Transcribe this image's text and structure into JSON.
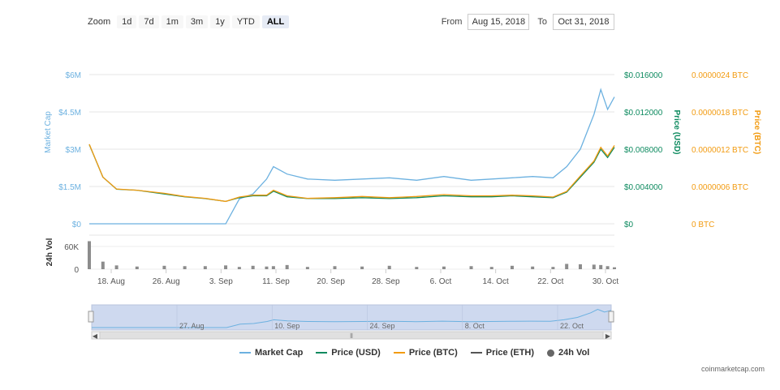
{
  "zoom": {
    "label": "Zoom",
    "buttons": [
      "1d",
      "7d",
      "1m",
      "3m",
      "1y",
      "YTD",
      "ALL"
    ],
    "active": "ALL"
  },
  "range": {
    "from_label": "From",
    "from_value": "Aug 15, 2018",
    "to_label": "To",
    "to_value": "Oct 31, 2018"
  },
  "credit": "coinmarketcap.com",
  "colors": {
    "market_cap": "#6cb1e0",
    "price_usd": "#0d8a5f",
    "price_btc": "#f29b11",
    "price_eth": "#555555",
    "volume": "#666666",
    "navigator_fill": "#ced9ef"
  },
  "legend": [
    {
      "label": "Market Cap",
      "icon": "line",
      "color": "#6cb1e0"
    },
    {
      "label": "Price (USD)",
      "icon": "line",
      "color": "#0d8a5f"
    },
    {
      "label": "Price (BTC)",
      "icon": "line",
      "color": "#f29b11"
    },
    {
      "label": "Price (ETH)",
      "icon": "line",
      "color": "#555555"
    },
    {
      "label": "24h Vol",
      "icon": "dot",
      "color": "#666666"
    }
  ],
  "chart_data": {
    "type": "line",
    "x": [
      "2018-08-15",
      "2018-08-17",
      "2018-08-19",
      "2018-08-22",
      "2018-08-26",
      "2018-08-29",
      "2018-09-01",
      "2018-09-04",
      "2018-09-06",
      "2018-09-08",
      "2018-09-10",
      "2018-09-11",
      "2018-09-13",
      "2018-09-16",
      "2018-09-20",
      "2018-09-24",
      "2018-09-28",
      "2018-10-02",
      "2018-10-06",
      "2018-10-10",
      "2018-10-13",
      "2018-10-16",
      "2018-10-19",
      "2018-10-22",
      "2018-10-24",
      "2018-10-26",
      "2018-10-28",
      "2018-10-29",
      "2018-10-30",
      "2018-10-31"
    ],
    "series": [
      {
        "name": "Market Cap",
        "axis": "market_cap",
        "values": [
          0,
          0,
          0,
          0,
          0,
          0,
          0,
          0,
          1.0,
          1.2,
          1.8,
          2.3,
          2.0,
          1.8,
          1.75,
          1.8,
          1.85,
          1.75,
          1.9,
          1.75,
          1.8,
          1.85,
          1.9,
          1.85,
          2.3,
          3.0,
          4.4,
          5.4,
          4.6,
          5.1
        ]
      },
      {
        "name": "Price (USD)",
        "axis": "usd",
        "values": [
          0.0085,
          0.005,
          0.0037,
          0.0036,
          0.0032,
          0.0029,
          0.0027,
          0.0024,
          0.0028,
          0.003,
          0.003,
          0.0035,
          0.0029,
          0.0027,
          0.0027,
          0.0028,
          0.0027,
          0.0028,
          0.003,
          0.0029,
          0.0029,
          0.003,
          0.0029,
          0.0028,
          0.0034,
          0.005,
          0.0066,
          0.008,
          0.0071,
          0.0082
        ]
      },
      {
        "name": "Price (BTC)",
        "axis": "btc",
        "values": [
          1.28e-06,
          7.5e-07,
          5.6e-07,
          5.4e-07,
          4.9e-07,
          4.4e-07,
          4.1e-07,
          3.6e-07,
          4.3e-07,
          4.6e-07,
          4.6e-07,
          5.4e-07,
          4.5e-07,
          4.1e-07,
          4.2e-07,
          4.4e-07,
          4.2e-07,
          4.4e-07,
          4.7e-07,
          4.5e-07,
          4.5e-07,
          4.6e-07,
          4.5e-07,
          4.3e-07,
          5.2e-07,
          7.7e-07,
          1.01e-06,
          1.23e-06,
          1.09e-06,
          1.26e-06
        ]
      },
      {
        "name": "24h Vol",
        "axis": "volume",
        "values": [
          74000,
          20000,
          10000,
          7000,
          9000,
          8000,
          8000,
          10000,
          6000,
          9000,
          7000,
          8000,
          11000,
          6000,
          8000,
          7000,
          9000,
          6000,
          7000,
          8000,
          6000,
          9000,
          7000,
          6000,
          14000,
          13000,
          12000,
          11000,
          8000,
          5000
        ]
      }
    ],
    "axes": {
      "x_ticks": [
        "18. Aug",
        "26. Aug",
        "3. Sep",
        "11. Sep",
        "20. Sep",
        "28. Sep",
        "6. Oct",
        "14. Oct",
        "22. Oct",
        "30. Oct"
      ],
      "market_cap": {
        "label": "Market Cap",
        "ticks": [
          "$0",
          "$1.5M",
          "$3M",
          "$4.5M",
          "$6M"
        ],
        "range": [
          0,
          6000000
        ]
      },
      "usd": {
        "label": "Price (USD)",
        "ticks": [
          "$0",
          "$0.004000",
          "$0.008000",
          "$0.012000",
          "$0.016000"
        ],
        "range": [
          0,
          0.016
        ]
      },
      "btc": {
        "label": "Price (BTC)",
        "ticks": [
          "0 BTC",
          "0.0000006 BTC",
          "0.0000012 BTC",
          "0.0000018 BTC",
          "0.0000024 BTC"
        ],
        "range": [
          0,
          2.4e-06
        ]
      },
      "volume": {
        "label": "24h Vol",
        "ticks": [
          "0",
          "60K"
        ],
        "range": [
          0,
          90000
        ]
      }
    },
    "navigator_ticks": [
      "27. Aug",
      "10. Sep",
      "24. Sep",
      "8. Oct",
      "22. Oct"
    ],
    "grid": true
  }
}
